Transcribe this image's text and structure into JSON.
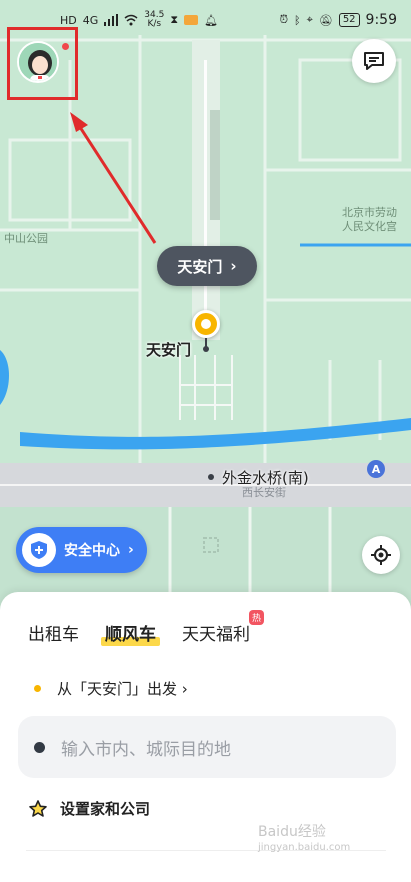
{
  "status_bar": {
    "left_indicators": [
      "HD",
      "4G"
    ],
    "network_speed": "34.5",
    "network_speed_unit": "K/s",
    "battery_level": "52",
    "time": "9:59"
  },
  "map": {
    "park_label": "中山公园",
    "venue_label_line1": "北京市劳动",
    "venue_label_line2": "人民文化宫",
    "place_pill": "天安门",
    "pin_label": "天安门",
    "bridge_label": "外金水桥(南)",
    "road_label": "西长安街",
    "metro_badge": "A"
  },
  "safety_button": {
    "label": "安全中心"
  },
  "panel": {
    "tabs": [
      {
        "label": "出租车"
      },
      {
        "label": "顺风车"
      },
      {
        "label": "天天福利",
        "badge": "热"
      }
    ],
    "from_text": "从「天安门」出发",
    "destination_placeholder": "输入市内、城际目的地",
    "set_home_label": "设置家和公司"
  },
  "watermark": {
    "brand": "Baidu经验",
    "url": "jingyan.baidu.com"
  },
  "colors": {
    "map_green": "#c8e8d3",
    "accent_yellow": "#f8b500",
    "highlight_underline": "#fcd84a",
    "safety_blue": "#3e7ef5",
    "river_blue": "#3ba4f0",
    "annotation_red": "#e02b2b"
  }
}
